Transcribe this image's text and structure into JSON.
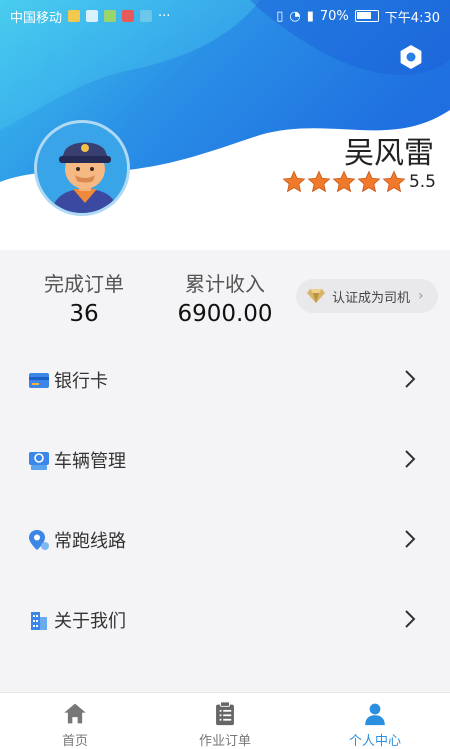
{
  "status_bar": {
    "carrier": "中国移动",
    "dots": "···",
    "battery": "70%",
    "time": "下午4:30"
  },
  "profile": {
    "name": "吴风雷",
    "rating": "5.5",
    "stars": 5
  },
  "stats": {
    "orders_label": "完成订单",
    "orders_value": "36",
    "income_label": "累计收入",
    "income_value": "6900.00",
    "cert_label": "认证成为司机"
  },
  "menu": {
    "items": [
      {
        "label": "银行卡",
        "icon": "bank-card-icon"
      },
      {
        "label": "车辆管理",
        "icon": "vehicle-icon"
      },
      {
        "label": "常跑线路",
        "icon": "route-pin-icon"
      },
      {
        "label": "关于我们",
        "icon": "building-icon"
      }
    ]
  },
  "tabbar": {
    "tabs": [
      {
        "label": "首页",
        "icon": "home-icon"
      },
      {
        "label": "作业订单",
        "icon": "clipboard-icon"
      },
      {
        "label": "个人中心",
        "icon": "person-icon"
      }
    ],
    "active": 2
  },
  "colors": {
    "accent": "#2b8fe0",
    "header_dark": "#1f6fe0",
    "header_light": "#33c7ee",
    "star": "#f07a2a"
  }
}
